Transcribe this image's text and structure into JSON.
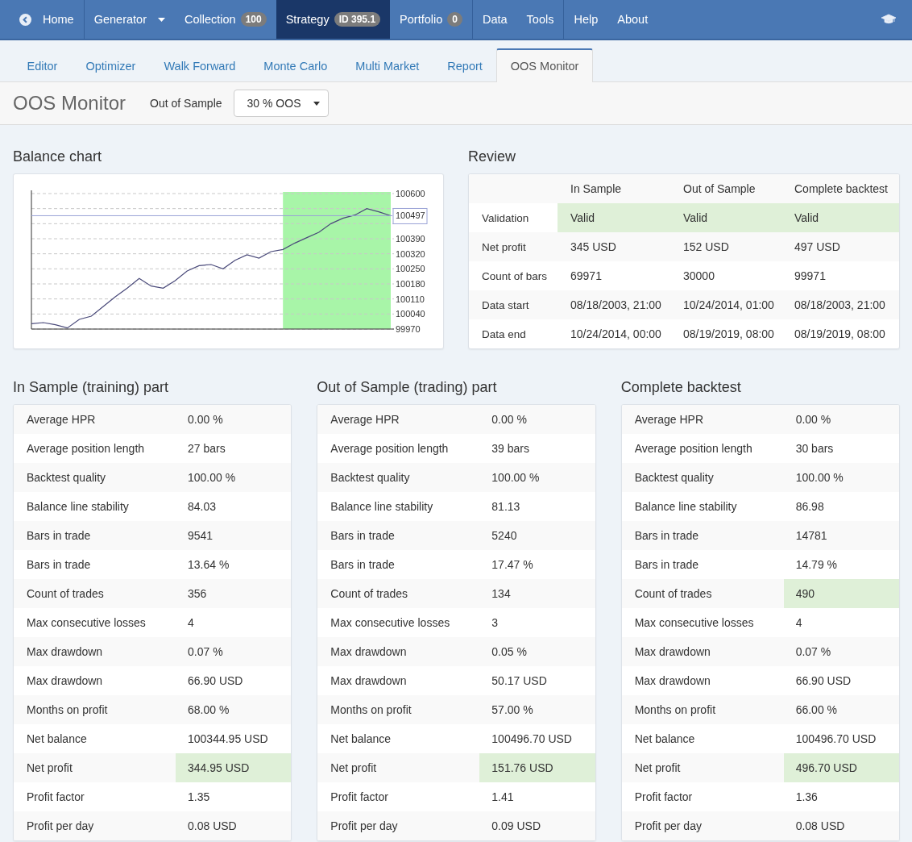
{
  "nav": {
    "items": [
      {
        "kind": "icon",
        "label": "Home",
        "selected": false,
        "divider_before": false
      },
      {
        "kind": "dropdown",
        "label": "Generator",
        "selected": false,
        "divider_before": true
      },
      {
        "kind": "badge",
        "label": "Collection",
        "badge": "100",
        "selected": false,
        "divider_before": false
      },
      {
        "kind": "badge",
        "label": "Strategy",
        "badge": "ID 395.1",
        "selected": true,
        "divider_before": false
      },
      {
        "kind": "badge",
        "label": "Portfolio",
        "badge": "0",
        "selected": false,
        "divider_before": false
      },
      {
        "kind": "plain",
        "label": "Data",
        "selected": false,
        "divider_before": true
      },
      {
        "kind": "plain",
        "label": "Tools",
        "selected": false,
        "divider_before": false
      },
      {
        "kind": "plain",
        "label": "Help",
        "selected": false,
        "divider_before": true
      },
      {
        "kind": "plain",
        "label": "About",
        "selected": false,
        "divider_before": false
      }
    ]
  },
  "tabs": [
    {
      "label": "Editor",
      "selected": false
    },
    {
      "label": "Optimizer",
      "selected": false
    },
    {
      "label": "Walk Forward",
      "selected": false
    },
    {
      "label": "Monte Carlo",
      "selected": false
    },
    {
      "label": "Multi Market",
      "selected": false
    },
    {
      "label": "Report",
      "selected": false
    },
    {
      "label": "OOS Monitor",
      "selected": true
    }
  ],
  "header": {
    "title": "OOS Monitor",
    "oos_label": "Out of Sample",
    "oos_value": "30 % OOS"
  },
  "balance": {
    "title": "Balance chart",
    "oos_band": {
      "level": 0.3
    },
    "chart_data": {
      "type": "line",
      "categories": [
        null,
        null,
        null,
        null,
        null,
        null,
        null,
        null,
        null,
        null,
        null,
        null,
        null,
        null,
        null,
        null,
        null,
        null,
        null,
        null,
        null,
        null,
        null,
        null,
        null,
        null,
        null,
        null,
        null,
        null,
        null
      ],
      "values": [
        99995,
        100000,
        99990,
        99975,
        100015,
        100030,
        100075,
        100120,
        100160,
        100205,
        100170,
        100160,
        100195,
        100240,
        100265,
        100270,
        100250,
        100290,
        100315,
        100300,
        100330,
        100340,
        100370,
        100395,
        100420,
        100460,
        100485,
        100500,
        100530,
        100515,
        100497
      ],
      "ylim": [
        99970,
        100600
      ],
      "yticks": [
        {
          "value": 99970,
          "label": "99970"
        },
        {
          "value": 100040,
          "label": "100040"
        },
        {
          "value": 100110,
          "label": "100110"
        },
        {
          "value": 100180,
          "label": "100180"
        },
        {
          "value": 100250,
          "label": "100250"
        },
        {
          "value": 100320,
          "label": "100320"
        },
        {
          "value": 100390,
          "label": "100390"
        },
        {
          "value": 100600,
          "label": "100600"
        }
      ],
      "grid": true,
      "ref_lines": [
        {
          "axis": "y",
          "value": 100497,
          "label": "100497"
        }
      ]
    }
  },
  "review": {
    "title": "Review",
    "columns": [
      "In Sample",
      "Out of Sample",
      "Complete backtest"
    ],
    "rows": [
      {
        "label": "Validation",
        "cells": [
          "Valid",
          "Valid",
          "Valid"
        ],
        "highlight": true
      },
      {
        "label": "Net profit",
        "cells": [
          "345 USD",
          "152 USD",
          "497 USD"
        ],
        "highlight": false
      },
      {
        "label": "Count of bars",
        "cells": [
          "69971",
          "30000",
          "99971"
        ],
        "highlight": false
      },
      {
        "label": "Data start",
        "cells": [
          "08/18/2003, 21:00",
          "10/24/2014, 01:00",
          "08/18/2003, 21:00"
        ],
        "highlight": false
      },
      {
        "label": "Data end",
        "cells": [
          "10/24/2014, 00:00",
          "08/19/2019, 08:00",
          "08/19/2019, 08:00"
        ],
        "highlight": false
      }
    ]
  },
  "parts": [
    {
      "title": "In Sample (training) part",
      "rows": [
        {
          "label": "Average HPR",
          "value": "0.00 %",
          "highlight": false
        },
        {
          "label": "Average position length",
          "value": "27 bars",
          "highlight": false
        },
        {
          "label": "Backtest quality",
          "value": "100.00 %",
          "highlight": false
        },
        {
          "label": "Balance line stability",
          "value": "84.03",
          "highlight": false
        },
        {
          "label": "Bars in trade",
          "value": "9541",
          "highlight": false
        },
        {
          "label": "Bars in trade",
          "value": "13.64 %",
          "highlight": false
        },
        {
          "label": "Count of trades",
          "value": "356",
          "highlight": false
        },
        {
          "label": "Max consecutive losses",
          "value": "4",
          "highlight": false
        },
        {
          "label": "Max drawdown",
          "value": "0.07 %",
          "highlight": false
        },
        {
          "label": "Max drawdown",
          "value": "66.90 USD",
          "highlight": false
        },
        {
          "label": "Months on profit",
          "value": "68.00 %",
          "highlight": false
        },
        {
          "label": "Net balance",
          "value": "100344.95 USD",
          "highlight": false
        },
        {
          "label": "Net profit",
          "value": "344.95 USD",
          "highlight": true
        },
        {
          "label": "Profit factor",
          "value": "1.35",
          "highlight": false
        },
        {
          "label": "Profit per day",
          "value": "0.08 USD",
          "highlight": false
        }
      ]
    },
    {
      "title": "Out of Sample (trading) part",
      "rows": [
        {
          "label": "Average HPR",
          "value": "0.00 %",
          "highlight": false
        },
        {
          "label": "Average position length",
          "value": "39 bars",
          "highlight": false
        },
        {
          "label": "Backtest quality",
          "value": "100.00 %",
          "highlight": false
        },
        {
          "label": "Balance line stability",
          "value": "81.13",
          "highlight": false
        },
        {
          "label": "Bars in trade",
          "value": "5240",
          "highlight": false
        },
        {
          "label": "Bars in trade",
          "value": "17.47 %",
          "highlight": false
        },
        {
          "label": "Count of trades",
          "value": "134",
          "highlight": false
        },
        {
          "label": "Max consecutive losses",
          "value": "3",
          "highlight": false
        },
        {
          "label": "Max drawdown",
          "value": "0.05 %",
          "highlight": false
        },
        {
          "label": "Max drawdown",
          "value": "50.17 USD",
          "highlight": false
        },
        {
          "label": "Months on profit",
          "value": "57.00 %",
          "highlight": false
        },
        {
          "label": "Net balance",
          "value": "100496.70 USD",
          "highlight": false
        },
        {
          "label": "Net profit",
          "value": "151.76 USD",
          "highlight": true
        },
        {
          "label": "Profit factor",
          "value": "1.41",
          "highlight": false
        },
        {
          "label": "Profit per day",
          "value": "0.09 USD",
          "highlight": false
        }
      ]
    },
    {
      "title": "Complete backtest",
      "rows": [
        {
          "label": "Average HPR",
          "value": "0.00 %",
          "highlight": false
        },
        {
          "label": "Average position length",
          "value": "30 bars",
          "highlight": false
        },
        {
          "label": "Backtest quality",
          "value": "100.00 %",
          "highlight": false
        },
        {
          "label": "Balance line stability",
          "value": "86.98",
          "highlight": false
        },
        {
          "label": "Bars in trade",
          "value": "14781",
          "highlight": false
        },
        {
          "label": "Bars in trade",
          "value": "14.79 %",
          "highlight": false
        },
        {
          "label": "Count of trades",
          "value": "490",
          "highlight": true
        },
        {
          "label": "Max consecutive losses",
          "value": "4",
          "highlight": false
        },
        {
          "label": "Max drawdown",
          "value": "0.07 %",
          "highlight": false
        },
        {
          "label": "Max drawdown",
          "value": "66.90 USD",
          "highlight": false
        },
        {
          "label": "Months on profit",
          "value": "66.00 %",
          "highlight": false
        },
        {
          "label": "Net balance",
          "value": "100496.70 USD",
          "highlight": false
        },
        {
          "label": "Net profit",
          "value": "496.70 USD",
          "highlight": true
        },
        {
          "label": "Profit factor",
          "value": "1.36",
          "highlight": false
        },
        {
          "label": "Profit per day",
          "value": "0.08 USD",
          "highlight": false
        }
      ]
    }
  ]
}
